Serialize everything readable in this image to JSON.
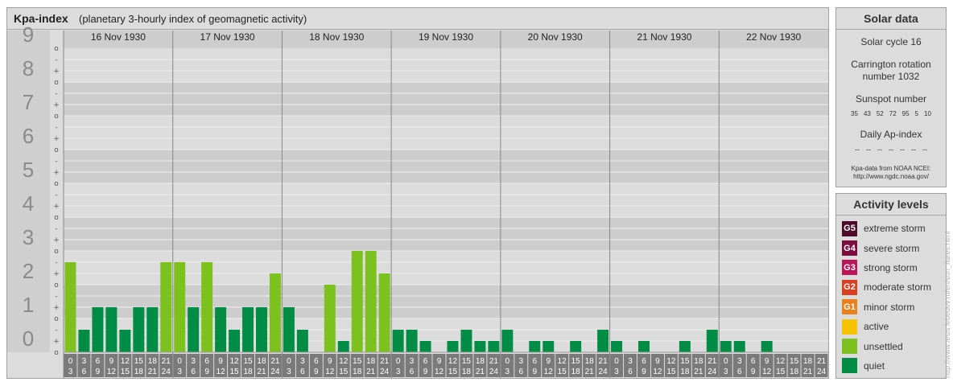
{
  "header": {
    "title": "Kpa-index",
    "subtitle": "(planetary 3-hourly index of geomagnetic activity)"
  },
  "chart_data": {
    "type": "bar",
    "ylim": [
      0,
      9
    ],
    "y_ticks": [
      "0",
      "1",
      "2",
      "3",
      "4",
      "5",
      "6",
      "7",
      "8",
      "9"
    ],
    "minor_labels": [
      "o",
      "+",
      "-",
      "o",
      "+",
      "-",
      "o",
      "+",
      "-",
      "o",
      "+",
      "-",
      "o",
      "+",
      "-",
      "o",
      "+",
      "-",
      "o",
      "+",
      "-",
      "o",
      "+",
      "-",
      "o",
      "+",
      "-",
      "o"
    ],
    "days": [
      "16 Nov 1930",
      "17 Nov 1930",
      "18 Nov 1930",
      "19 Nov 1930",
      "20 Nov 1930",
      "21 Nov 1930",
      "22 Nov 1930"
    ],
    "interval_labels": [
      [
        "0",
        "3"
      ],
      [
        "3",
        "6"
      ],
      [
        "6",
        "9"
      ],
      [
        "9",
        "12"
      ],
      [
        "12",
        "15"
      ],
      [
        "15",
        "18"
      ],
      [
        "18",
        "21"
      ],
      [
        "21",
        "24"
      ]
    ],
    "values": [
      [
        2.667,
        0.667,
        1.333,
        1.333,
        0.667,
        1.333,
        1.333,
        2.667
      ],
      [
        2.667,
        1.333,
        2.667,
        1.333,
        0.667,
        1.333,
        1.333,
        2.333
      ],
      [
        1.333,
        0.667,
        0,
        2,
        0.333,
        3,
        3,
        2.333
      ],
      [
        0.667,
        0.667,
        0.333,
        0,
        0.333,
        0.667,
        0.333,
        0.333
      ],
      [
        0.667,
        0,
        0.333,
        0.333,
        0,
        0.333,
        0,
        0.667
      ],
      [
        0.333,
        0,
        0.333,
        0,
        0,
        0.333,
        0,
        0.667
      ],
      [
        0.333,
        0.333,
        0,
        0.333,
        0,
        0,
        0,
        0
      ]
    ],
    "colors": {
      "quiet": "#008c44",
      "unsettled": "#7dc11e"
    }
  },
  "solar": {
    "title": "Solar data",
    "cycle": "Solar cycle 16",
    "carrington_1": "Carrington rotation",
    "carrington_2": "number 1032",
    "sunspot_label": "Sunspot number",
    "sunspots": [
      "35",
      "43",
      "52",
      "72",
      "95",
      "5",
      "10"
    ],
    "ap_label": "Daily Ap-index",
    "ap_values": [
      "--",
      "--",
      "--",
      "--",
      "--",
      "--",
      "--"
    ],
    "source_1": "Kpa-data from NOAA NCEI:",
    "source_2": "http://www.ngdc.noaa.gov/"
  },
  "activity": {
    "title": "Activity levels",
    "levels": [
      {
        "code": "G5",
        "label": "extreme storm",
        "color": "#4d0b2a"
      },
      {
        "code": "G4",
        "label": "severe storm",
        "color": "#7a0f3f"
      },
      {
        "code": "G3",
        "label": "strong storm",
        "color": "#b8185a"
      },
      {
        "code": "G2",
        "label": "moderate storm",
        "color": "#d9401f"
      },
      {
        "code": "G1",
        "label": "minor storm",
        "color": "#e8811d"
      },
      {
        "code": "",
        "label": "active",
        "color": "#f7c200"
      },
      {
        "code": "",
        "label": "unsettled",
        "color": "#7dc11e"
      },
      {
        "code": "",
        "label": "quiet",
        "color": "#008c44"
      }
    ]
  },
  "watermark": "http://www.tesis.lebedev.ru/en/sun_flares.html"
}
